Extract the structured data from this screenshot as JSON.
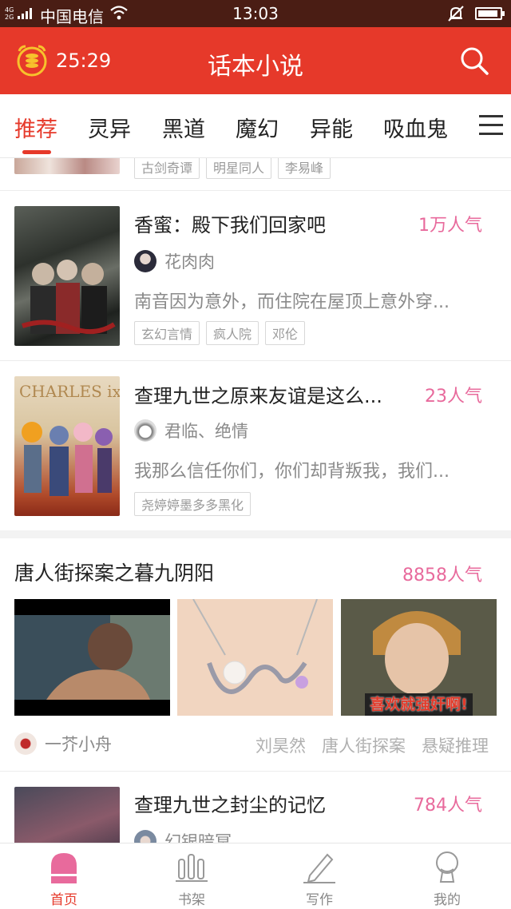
{
  "status_bar": {
    "network": "4G 2G",
    "carrier": "中国电信",
    "time": "13:03"
  },
  "header": {
    "timer": "25:29",
    "title": "话本小说",
    "icons": [
      "alarm-coin-icon",
      "search-icon"
    ]
  },
  "tabs": [
    "推荐",
    "灵异",
    "黑道",
    "魔幻",
    "异能",
    "吸血鬼"
  ],
  "partial_card": {
    "tags": [
      "古剑奇谭",
      "明星同人",
      "李易峰"
    ]
  },
  "books": [
    {
      "title": "香蜜：殿下我们回家吧",
      "popularity": "1万人气",
      "author": "花肉肉",
      "description": "南音因为意外，而住院在屋顶上意外穿...",
      "tags": [
        "玄幻言情",
        "疯人院",
        "邓伦"
      ]
    },
    {
      "title": "查理九世之原来友谊是这么...",
      "popularity": "23人气",
      "author": "君临、绝情",
      "description": "我那么信任你们，你们却背叛我，我们...",
      "tags": [
        "尧婷婷墨多多黑化"
      ]
    }
  ],
  "feature": {
    "title": "唐人街探案之暮九阴阳",
    "popularity": "8858人气",
    "author": "一芥小舟",
    "tags": [
      "刘昊然",
      "唐人街探案",
      "悬疑推理"
    ],
    "thumb_caption": "喜欢就强奸啊!"
  },
  "last_book": {
    "title": "查理九世之封尘的记忆",
    "popularity": "784人气",
    "author": "幻银暗冥"
  },
  "bottom_nav": [
    "首页",
    "书架",
    "写作",
    "我的"
  ],
  "colors": {
    "brand_red": "#e6392a",
    "popularity_pink": "#e86a9c",
    "status_bar": "#4a1d14"
  }
}
